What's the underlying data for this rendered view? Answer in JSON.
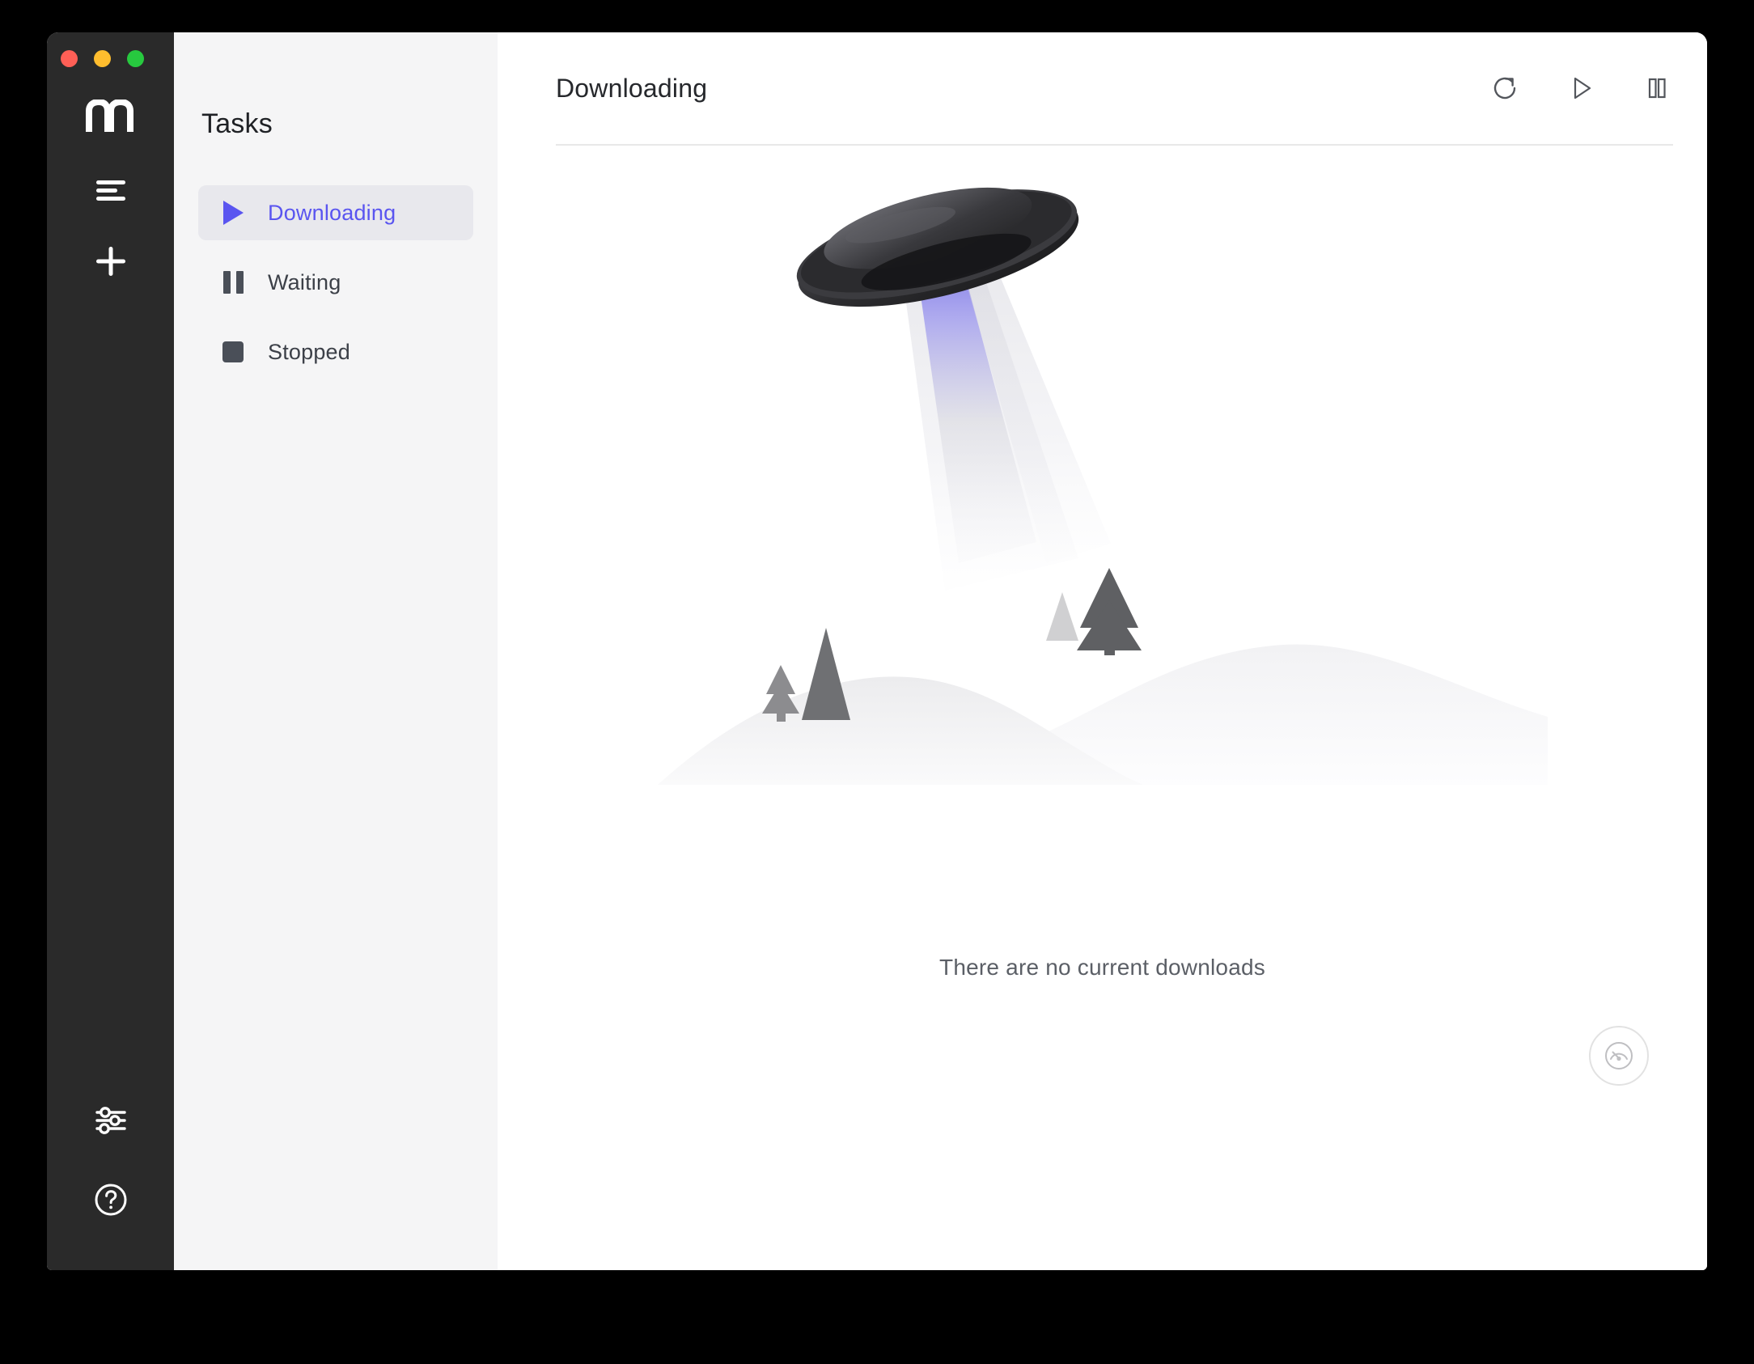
{
  "window": {
    "traffic_lights": [
      {
        "name": "close",
        "color": "#ff5f56"
      },
      {
        "name": "minimize",
        "color": "#ffbd2e"
      },
      {
        "name": "maximize",
        "color": "#27c93f"
      }
    ]
  },
  "rail": {
    "brand_logo": "motrix-m-logo",
    "buttons": [
      {
        "icon": "list-icon",
        "name": "task-list-button"
      },
      {
        "icon": "plus-icon",
        "name": "add-task-button"
      },
      {
        "icon": "sliders-icon",
        "name": "preferences-button"
      },
      {
        "icon": "question-circle-icon",
        "name": "help-button"
      }
    ]
  },
  "sidebar": {
    "title": "Tasks",
    "items": [
      {
        "label": "Downloading",
        "icon": "play-icon",
        "active": true
      },
      {
        "label": "Waiting",
        "icon": "pause-icon",
        "active": false
      },
      {
        "label": "Stopped",
        "icon": "stop-icon",
        "active": false
      }
    ]
  },
  "main": {
    "title": "Downloading",
    "actions": [
      {
        "label": "Refresh",
        "icon": "refresh-icon"
      },
      {
        "label": "Resume All",
        "icon": "play-icon"
      },
      {
        "label": "Pause All",
        "icon": "pause-icon"
      }
    ],
    "empty_message": "There are no current downloads",
    "illustration": "ufo-abducting-over-hills",
    "speed_badge_icon": "speedometer-icon"
  },
  "colors": {
    "accent": "#5a55f0",
    "rail_bg": "#2a2a2a",
    "panel_bg": "#f5f5f6",
    "active_item_bg": "#e8e8ed",
    "text_primary": "#26282c",
    "text_secondary": "#5b5f66",
    "beam_blue": "#6b64e8"
  }
}
